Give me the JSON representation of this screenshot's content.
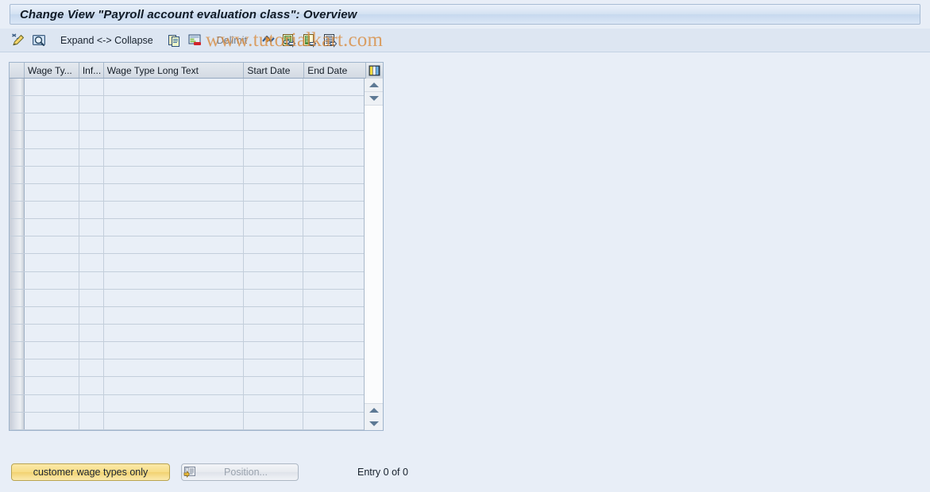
{
  "window": {
    "title": "Change View \"Payroll account evaluation class\": Overview"
  },
  "toolbar": {
    "items": [
      {
        "name": "change-pencil-icon",
        "type": "icon",
        "icon": "pencil-icon",
        "label": ""
      },
      {
        "name": "display-details-icon",
        "type": "icon",
        "icon": "magnifier-screen-icon",
        "label": ""
      },
      {
        "name": "expand-collapse",
        "type": "label",
        "icon": "",
        "label": "Expand <-> Collapse"
      },
      {
        "name": "copy-as-icon",
        "type": "icon",
        "icon": "copy-documents-icon",
        "label": ""
      },
      {
        "name": "delete-row-icon",
        "type": "icon",
        "icon": "delete-row-icon",
        "label": ""
      },
      {
        "name": "delimit",
        "type": "label",
        "icon": "",
        "label": "Delimit"
      },
      {
        "name": "undo-icon",
        "type": "icon",
        "icon": "undo-arrow-icon",
        "label": ""
      },
      {
        "name": "previous-entry-icon",
        "type": "icon",
        "icon": "previous-entry-icon",
        "label": ""
      },
      {
        "name": "next-entry-icon",
        "type": "icon",
        "icon": "next-entry-icon",
        "label": ""
      },
      {
        "name": "variants-icon",
        "type": "icon",
        "icon": "select-layout-icon",
        "label": ""
      }
    ]
  },
  "watermark": {
    "text": "www.tutorialkart.com",
    "color": "#d98a3c"
  },
  "table": {
    "columns": [
      {
        "key": "selector",
        "label": ""
      },
      {
        "key": "wage_type",
        "label": "Wage Ty..."
      },
      {
        "key": "infotype",
        "label": "Inf..."
      },
      {
        "key": "wage_type_long_text",
        "label": "Wage Type Long Text"
      },
      {
        "key": "start_date",
        "label": "Start Date"
      },
      {
        "key": "end_date",
        "label": "End Date"
      }
    ],
    "corner_button": "select-all-layout-icon",
    "rows": [],
    "empty_row_count": 20,
    "scrollbar": {
      "up_arrow": "arrow-up-icon",
      "down_arrow": "arrow-down-icon"
    }
  },
  "footer": {
    "customer_button_label": "customer wage types only",
    "position_button_label": "Position...",
    "position_button_icon": "position-icon",
    "entry_count": "Entry 0 of 0"
  },
  "colors": {
    "page_background": "#e8eef7",
    "titlebar_background": "#d4e2f2",
    "toolbar_background": "#dde6f2",
    "table_cell_background": "#e9eff7",
    "accent_yellow": "#f7dd86",
    "grid_line": "#c3cedb"
  }
}
